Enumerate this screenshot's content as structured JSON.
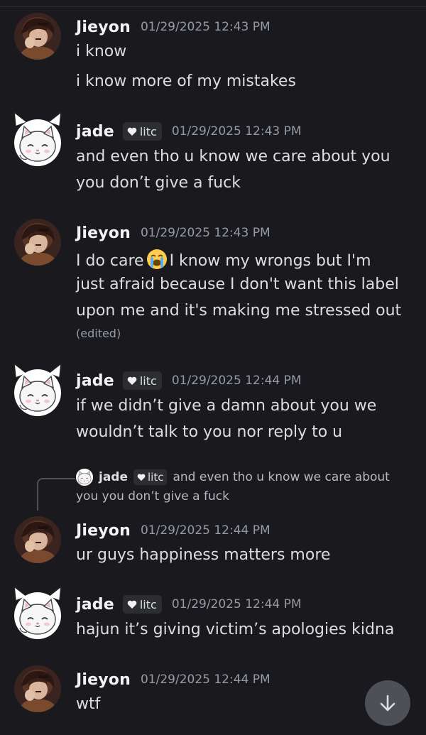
{
  "colors": {
    "background": "#1a1a1e",
    "username": "#f2f3f5",
    "message_text": "#dbdee1",
    "timestamp": "#949ba4",
    "badge_bg": "#2b2d31",
    "scroll_button_bg": "#4e5058"
  },
  "users": {
    "jieyon": {
      "name": "Jieyon",
      "avatar_icon": "jieyon-avatar-icon"
    },
    "jade": {
      "name": "jade",
      "avatar_icon": "jade-cat-avatar-icon",
      "badge_icon": "heart-icon",
      "badge_label": "litc"
    }
  },
  "messages": [
    {
      "author": "Jieyon",
      "timestamp": "01/29/2025 12:43 PM",
      "lines": [
        "i know",
        "i know more of my mistakes"
      ]
    },
    {
      "author": "jade",
      "badge": "litc",
      "timestamp": "01/29/2025 12:43 PM",
      "lines": [
        "and even tho u know we care about you",
        "you don’t give a fuck"
      ]
    },
    {
      "author": "Jieyon",
      "timestamp": "01/29/2025 12:43 PM",
      "lines": [
        "I do care",
        "I know my wrongs but I'm",
        "just afraid because I don't want this label",
        "upon me and it's making me stressed out"
      ],
      "emoji_icon": "loudly-crying-face-emoji",
      "edited": "(edited)"
    },
    {
      "author": "jade",
      "badge": "litc",
      "timestamp": "01/29/2025 12:44 PM",
      "lines": [
        "if we didn’t give a damn about you we",
        "wouldn’t talk to you nor reply to u"
      ]
    },
    {
      "author": "Jieyon",
      "timestamp": "01/29/2025 12:44 PM",
      "reply": {
        "author": "jade",
        "badge": "litc",
        "text_line1": "and even tho u know we care about",
        "text_line2": "you you don’t give a fuck"
      },
      "lines": [
        "ur guys happiness matters more"
      ]
    },
    {
      "author": "jade",
      "badge": "litc",
      "timestamp": "01/29/2025 12:44 PM",
      "lines": [
        "hajun it’s giving victim’s apologies kidna"
      ]
    },
    {
      "author": "Jieyon",
      "timestamp": "01/29/2025 12:44 PM",
      "lines": [
        "wtf"
      ]
    }
  ],
  "scroll_button": {
    "icon": "arrow-down-icon"
  }
}
